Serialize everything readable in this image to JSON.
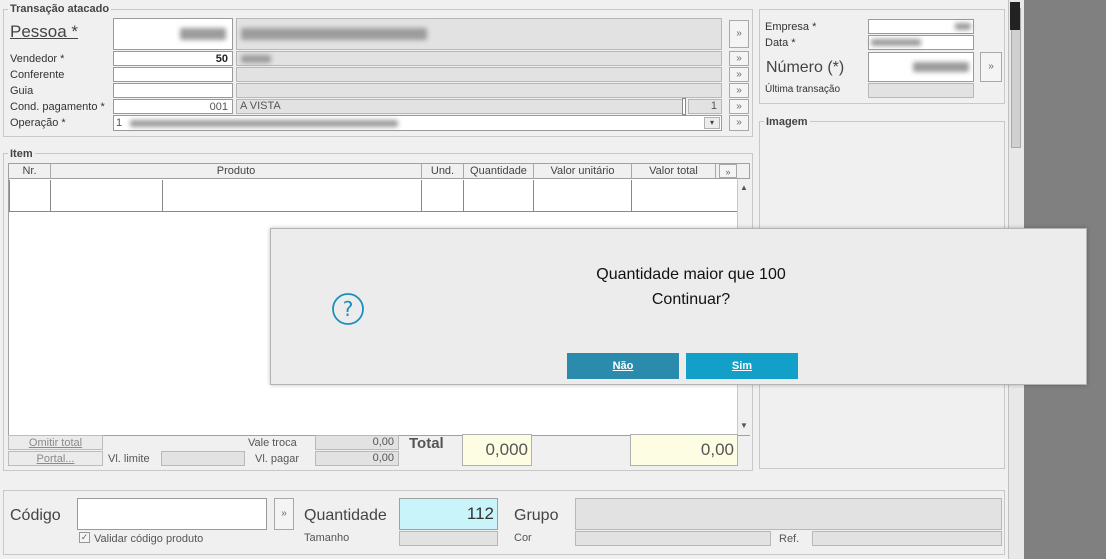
{
  "transacao": {
    "group_label": "Transação atacado",
    "pessoa_label": "Pessoa *",
    "vendedor_label": "Vendedor *",
    "vendedor_value": "50",
    "conferente_label": "Conferente",
    "guia_label": "Guia",
    "cond_pagamento_label": "Cond. pagamento *",
    "cond_pagamento_code": "001",
    "cond_pagamento_desc": "A VISTA",
    "cond_pagamento_parcelas": "1",
    "operacao_label": "Operação *",
    "operacao_prefix": "1"
  },
  "empresa": {
    "empresa_label": "Empresa *",
    "data_label": "Data *",
    "numero_label": "Número (*)",
    "ultima_label": "Última transação"
  },
  "imagem": {
    "label": "Imagem"
  },
  "item": {
    "group_label": "Item",
    "columns": [
      "Nr.",
      "Produto",
      "Und.",
      "Quantidade",
      "Valor unitário",
      "Valor total"
    ],
    "omitir_total_label": "Omitir total",
    "portal_label": "Portal...",
    "vl_limite_label": "Vl. limite",
    "vale_troca_label": "Vale troca",
    "vale_troca_value": "0,00",
    "vl_pagar_label": "Vl. pagar",
    "vl_pagar_value": "0,00",
    "total_label": "Total",
    "total_quantidade": "0,000",
    "total_valor": "0,00"
  },
  "bottom": {
    "codigo_label": "Código",
    "validar_label": "Validar código produto",
    "validar_checked": true,
    "quantidade_label": "Quantidade",
    "quantidade_value": "112",
    "grupo_label": "Grupo",
    "tamanho_label": "Tamanho",
    "cor_label": "Cor",
    "ref_label": "Ref."
  },
  "dialog": {
    "line1": "Quantidade maior que 100",
    "line2": "Continuar?",
    "icon": "question-icon",
    "no_label": "Não",
    "yes_label": "Sim",
    "no_color": "#2a8bad",
    "yes_color": "#12a0c8",
    "accent": "#1a90c0"
  }
}
